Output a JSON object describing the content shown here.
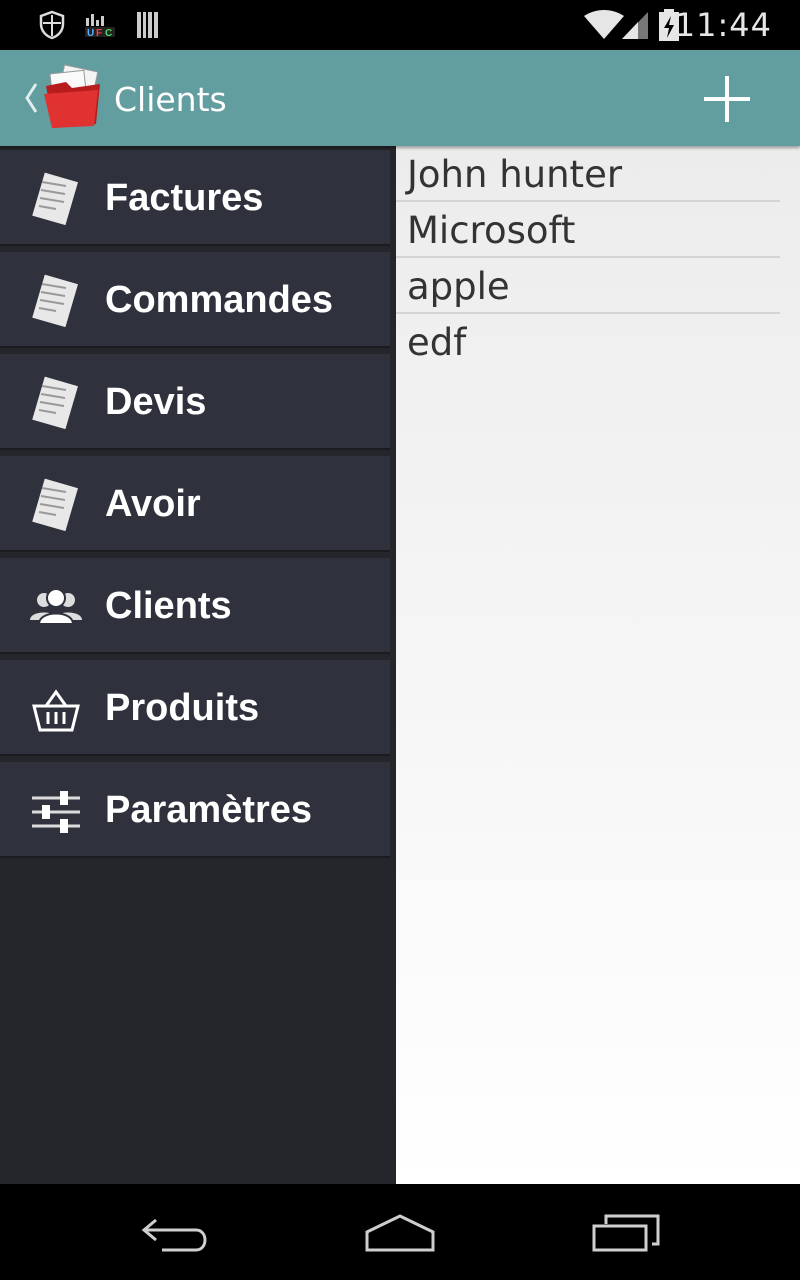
{
  "status_bar": {
    "time": "11:44",
    "left_icons": [
      "shield-icon",
      "ufc-app-icon",
      "barcode-icon"
    ],
    "right_icons": [
      "wifi-icon",
      "cell-signal-icon",
      "battery-charging-icon"
    ]
  },
  "action_bar": {
    "title": "Clients",
    "app_icon": "red-folder-icon",
    "action_icon": "add-icon"
  },
  "drawer": {
    "items": [
      {
        "label": "Factures",
        "icon": "invoice-icon"
      },
      {
        "label": "Commandes",
        "icon": "invoice-icon"
      },
      {
        "label": "Devis",
        "icon": "invoice-icon"
      },
      {
        "label": "Avoir",
        "icon": "invoice-icon"
      },
      {
        "label": "Clients",
        "icon": "people-icon"
      },
      {
        "label": "Produits",
        "icon": "basket-icon"
      },
      {
        "label": "Paramètres",
        "icon": "sliders-icon"
      }
    ]
  },
  "clients": {
    "items": [
      "John hunter",
      "Microsoft",
      "apple",
      "edf"
    ]
  },
  "nav_bar": {
    "buttons": [
      "back-icon",
      "home-icon",
      "recents-icon"
    ]
  },
  "colors": {
    "action_bar": "#629d9f",
    "drawer_item": "#2f323d",
    "drawer_bg": "#25262b",
    "app_icon_red": "#d42a2a"
  }
}
